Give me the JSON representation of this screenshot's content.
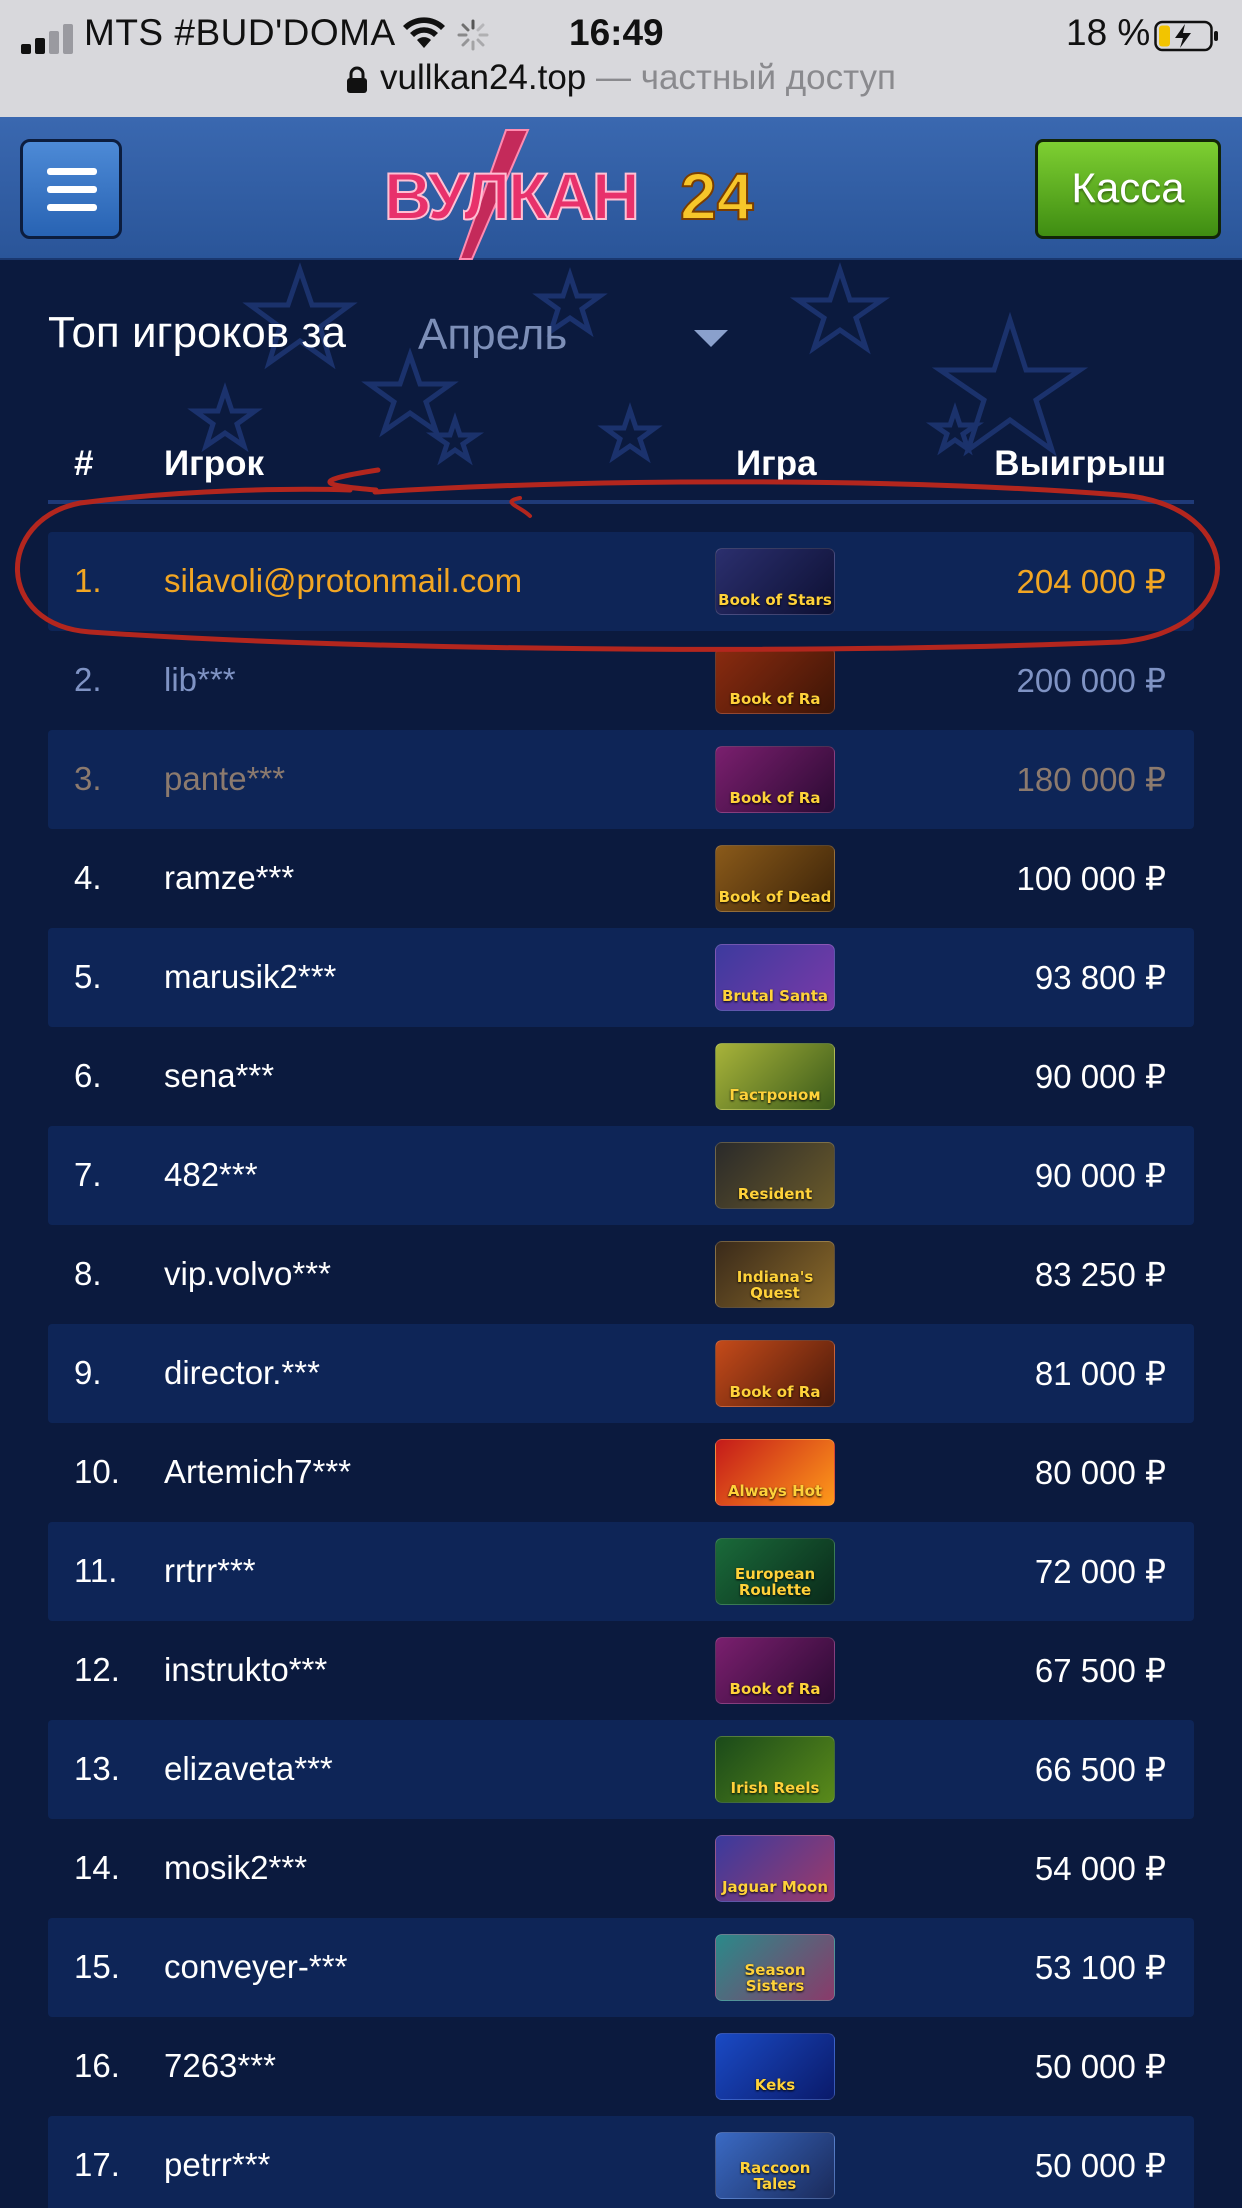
{
  "status_bar": {
    "carrier": "MTS #BUD'DOMA",
    "time": "16:49",
    "battery": "18 %",
    "url_domain": "vullkan24.top",
    "url_suffix": " — частный доступ"
  },
  "header": {
    "logo_text": "ВУЛКАН",
    "logo_number": "24",
    "kassa_label": "Касса"
  },
  "leaderboard": {
    "heading": "Топ игроков за",
    "month": "Апрель",
    "columns": {
      "num": "#",
      "player": "Игрок",
      "game": "Игра",
      "win": "Выигрыш"
    },
    "rows": [
      {
        "num": "1.",
        "player": "silavoli@protonmail.com",
        "game": "Book of Stars",
        "win": "204 000 ₽"
      },
      {
        "num": "2.",
        "player": "lib***",
        "game": "Book of Ra",
        "win": "200 000 ₽"
      },
      {
        "num": "3.",
        "player": "pante***",
        "game": "Book of Ra",
        "win": "180 000 ₽"
      },
      {
        "num": "4.",
        "player": "ramze***",
        "game": "Book of Dead",
        "win": "100 000 ₽"
      },
      {
        "num": "5.",
        "player": "marusik2***",
        "game": "Brutal Santa",
        "win": "93 800 ₽"
      },
      {
        "num": "6.",
        "player": "sena***",
        "game": "Гастроном",
        "win": "90 000 ₽"
      },
      {
        "num": "7.",
        "player": "482***",
        "game": "Resident",
        "win": "90 000 ₽"
      },
      {
        "num": "8.",
        "player": "vip.volvo***",
        "game": "Indiana's Quest",
        "win": "83 250 ₽"
      },
      {
        "num": "9.",
        "player": "director.***",
        "game": "Book of Ra",
        "win": "81 000 ₽"
      },
      {
        "num": "10.",
        "player": "Artemich7***",
        "game": "Always Hot",
        "win": "80 000 ₽"
      },
      {
        "num": "11.",
        "player": "rrtrr***",
        "game": "European Roulette",
        "win": "72 000 ₽"
      },
      {
        "num": "12.",
        "player": "instrukto***",
        "game": "Book of Ra",
        "win": "67 500 ₽"
      },
      {
        "num": "13.",
        "player": "elizaveta***",
        "game": "Irish Reels",
        "win": "66 500 ₽"
      },
      {
        "num": "14.",
        "player": "mosik2***",
        "game": "Jaguar Moon",
        "win": "54 000 ₽"
      },
      {
        "num": "15.",
        "player": "conveyer-***",
        "game": "Season Sisters",
        "win": "53 100 ₽"
      },
      {
        "num": "16.",
        "player": "7263***",
        "game": "Keks",
        "win": "50 000 ₽"
      },
      {
        "num": "17.",
        "player": "petrr***",
        "game": "Raccoon Tales",
        "win": "50 000 ₽"
      }
    ]
  },
  "colors": {
    "background": "#0b1a3e",
    "row_alt": "#0e2557",
    "header_blue": "#2f5ca3",
    "gold": "#f2a623",
    "silver": "#7f93c4",
    "bronze": "#8c7a6e",
    "kassa_green": "#5aab22",
    "annotation_red": "#b3261e"
  }
}
